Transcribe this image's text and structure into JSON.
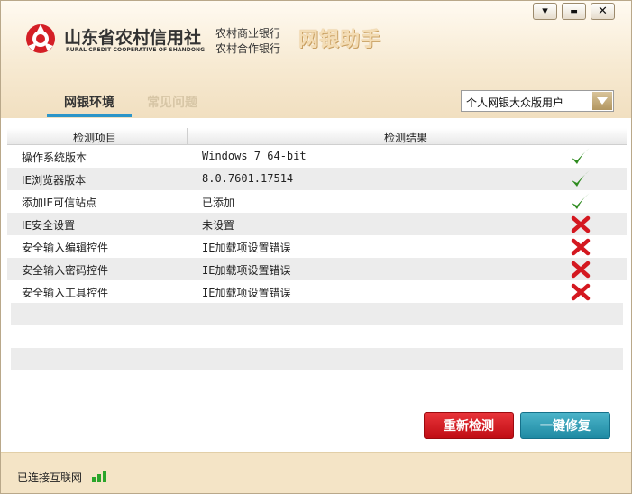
{
  "brand": {
    "name": "山东省农村信用社",
    "subtitle": "RURAL CREDIT COOPERATIVE OF SHANDONG",
    "bank_line1": "农村商业银行",
    "bank_line2": "农村合作银行",
    "app_title": "网银助手"
  },
  "window_controls": {
    "menu": "▾",
    "minimize": "▬",
    "close": "✕"
  },
  "tabs": [
    {
      "label": "网银环境",
      "active": true
    },
    {
      "label": "常见问题",
      "active": false
    }
  ],
  "user_type": {
    "selected": "个人网银大众版用户"
  },
  "table": {
    "headers": [
      "检测项目",
      "检测结果"
    ],
    "rows": [
      {
        "item": "操作系统版本",
        "result": "Windows 7 64-bit",
        "status": "ok"
      },
      {
        "item": "IE浏览器版本",
        "result": "8.0.7601.17514",
        "status": "ok"
      },
      {
        "item": "添加IE可信站点",
        "result": "已添加",
        "status": "ok"
      },
      {
        "item": "IE安全设置",
        "result": "未设置",
        "status": "error"
      },
      {
        "item": "安全输入编辑控件",
        "result": "IE加载项设置错误",
        "status": "error"
      },
      {
        "item": "安全输入密码控件",
        "result": "IE加载项设置错误",
        "status": "error"
      },
      {
        "item": "安全输入工具控件",
        "result": "IE加载项设置错误",
        "status": "error"
      }
    ]
  },
  "buttons": {
    "recheck": "重新检测",
    "repair": "一键修复"
  },
  "status_bar": {
    "connection": "已连接互联网"
  },
  "colors": {
    "ok": "#2e8b1f",
    "error": "#d41820",
    "tab_underline": "#2c95c9",
    "header_bg": "#f7ead2"
  }
}
